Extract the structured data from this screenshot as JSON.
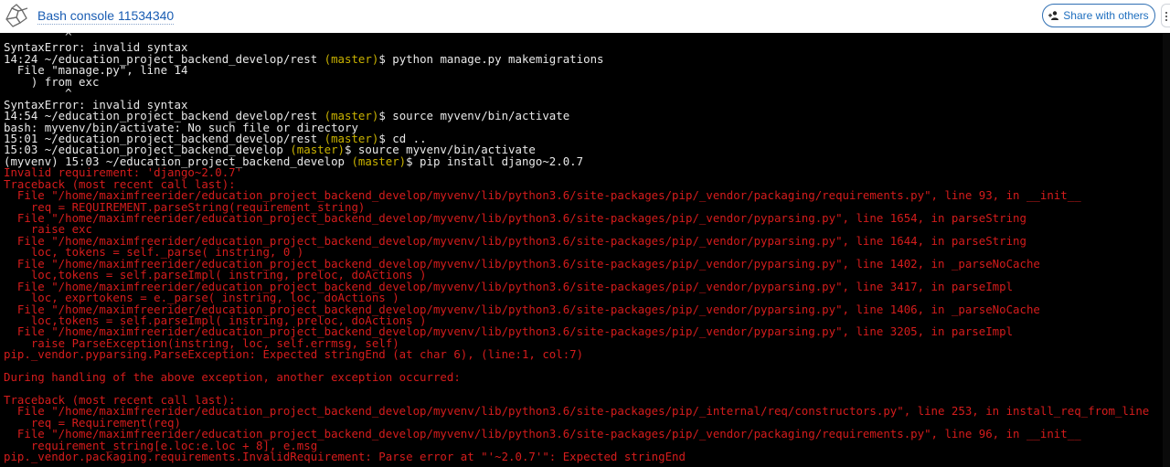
{
  "header": {
    "title": "Bash console 11534340",
    "share_label": "Share with others",
    "logo_icon": "pythonanywhere-logo-icon",
    "share_icon": "person-add-icon",
    "more_icon": "more-vertical-icon"
  },
  "colors": {
    "prompt_branch": "#c9b200",
    "error_text": "#d51c1c",
    "normal_text": "#e8e8e8",
    "terminal_bg": "#000000",
    "title_link": "#1a5db3"
  },
  "terminal": {
    "lines": [
      {
        "t": "w",
        "text": "         ^"
      },
      {
        "t": "w",
        "text": "SyntaxError: invalid syntax"
      },
      {
        "t": "prompt",
        "pre": "14:24 ~/education_project_backend_develop/rest ",
        "branch": "(master)",
        "post": "$ python manage.py makemigrations"
      },
      {
        "t": "w",
        "text": "  File \"manage.py\", line 14"
      },
      {
        "t": "w",
        "text": "    ) from exc"
      },
      {
        "t": "w",
        "text": "         ^"
      },
      {
        "t": "w",
        "text": "SyntaxError: invalid syntax"
      },
      {
        "t": "prompt",
        "pre": "14:54 ~/education_project_backend_develop/rest ",
        "branch": "(master)",
        "post": "$ source myvenv/bin/activate"
      },
      {
        "t": "w",
        "text": "bash: myvenv/bin/activate: No such file or directory"
      },
      {
        "t": "prompt",
        "pre": "15:01 ~/education_project_backend_develop/rest ",
        "branch": "(master)",
        "post": "$ cd .."
      },
      {
        "t": "prompt",
        "pre": "15:03 ~/education_project_backend_develop ",
        "branch": "(master)",
        "post": "$ source myvenv/bin/activate"
      },
      {
        "t": "prompt",
        "pre": "(myvenv) 15:03 ~/education_project_backend_develop ",
        "branch": "(master)",
        "post": "$ pip install django~2.0.7"
      },
      {
        "t": "r",
        "text": "Invalid requirement: 'django~2.0.7'"
      },
      {
        "t": "r",
        "text": "Traceback (most recent call last):"
      },
      {
        "t": "r",
        "text": "  File \"/home/maximfreerider/education_project_backend_develop/myvenv/lib/python3.6/site-packages/pip/_vendor/packaging/requirements.py\", line 93, in __init__"
      },
      {
        "t": "r",
        "text": "    req = REQUIREMENT.parseString(requirement_string)"
      },
      {
        "t": "r",
        "text": "  File \"/home/maximfreerider/education_project_backend_develop/myvenv/lib/python3.6/site-packages/pip/_vendor/pyparsing.py\", line 1654, in parseString"
      },
      {
        "t": "r",
        "text": "    raise exc"
      },
      {
        "t": "r",
        "text": "  File \"/home/maximfreerider/education_project_backend_develop/myvenv/lib/python3.6/site-packages/pip/_vendor/pyparsing.py\", line 1644, in parseString"
      },
      {
        "t": "r",
        "text": "    loc, tokens = self._parse( instring, 0 )"
      },
      {
        "t": "r",
        "text": "  File \"/home/maximfreerider/education_project_backend_develop/myvenv/lib/python3.6/site-packages/pip/_vendor/pyparsing.py\", line 1402, in _parseNoCache"
      },
      {
        "t": "r",
        "text": "    loc,tokens = self.parseImpl( instring, preloc, doActions )"
      },
      {
        "t": "r",
        "text": "  File \"/home/maximfreerider/education_project_backend_develop/myvenv/lib/python3.6/site-packages/pip/_vendor/pyparsing.py\", line 3417, in parseImpl"
      },
      {
        "t": "r",
        "text": "    loc, exprtokens = e._parse( instring, loc, doActions )"
      },
      {
        "t": "r",
        "text": "  File \"/home/maximfreerider/education_project_backend_develop/myvenv/lib/python3.6/site-packages/pip/_vendor/pyparsing.py\", line 1406, in _parseNoCache"
      },
      {
        "t": "r",
        "text": "    loc,tokens = self.parseImpl( instring, preloc, doActions )"
      },
      {
        "t": "r",
        "text": "  File \"/home/maximfreerider/education_project_backend_develop/myvenv/lib/python3.6/site-packages/pip/_vendor/pyparsing.py\", line 3205, in parseImpl"
      },
      {
        "t": "r",
        "text": "    raise ParseException(instring, loc, self.errmsg, self)"
      },
      {
        "t": "r",
        "text": "pip._vendor.pyparsing.ParseException: Expected stringEnd (at char 6), (line:1, col:7)"
      },
      {
        "t": "r",
        "text": ""
      },
      {
        "t": "r",
        "text": "During handling of the above exception, another exception occurred:"
      },
      {
        "t": "r",
        "text": ""
      },
      {
        "t": "r",
        "text": "Traceback (most recent call last):"
      },
      {
        "t": "r",
        "text": "  File \"/home/maximfreerider/education_project_backend_develop/myvenv/lib/python3.6/site-packages/pip/_internal/req/constructors.py\", line 253, in install_req_from_line"
      },
      {
        "t": "r",
        "text": "    req = Requirement(req)"
      },
      {
        "t": "r",
        "text": "  File \"/home/maximfreerider/education_project_backend_develop/myvenv/lib/python3.6/site-packages/pip/_vendor/packaging/requirements.py\", line 96, in __init__"
      },
      {
        "t": "r",
        "text": "    requirement_string[e.loc:e.loc + 8], e.msg"
      },
      {
        "t": "r",
        "text": "pip._vendor.packaging.requirements.InvalidRequirement: Parse error at \"'~2.0.7'\": Expected stringEnd"
      }
    ]
  }
}
